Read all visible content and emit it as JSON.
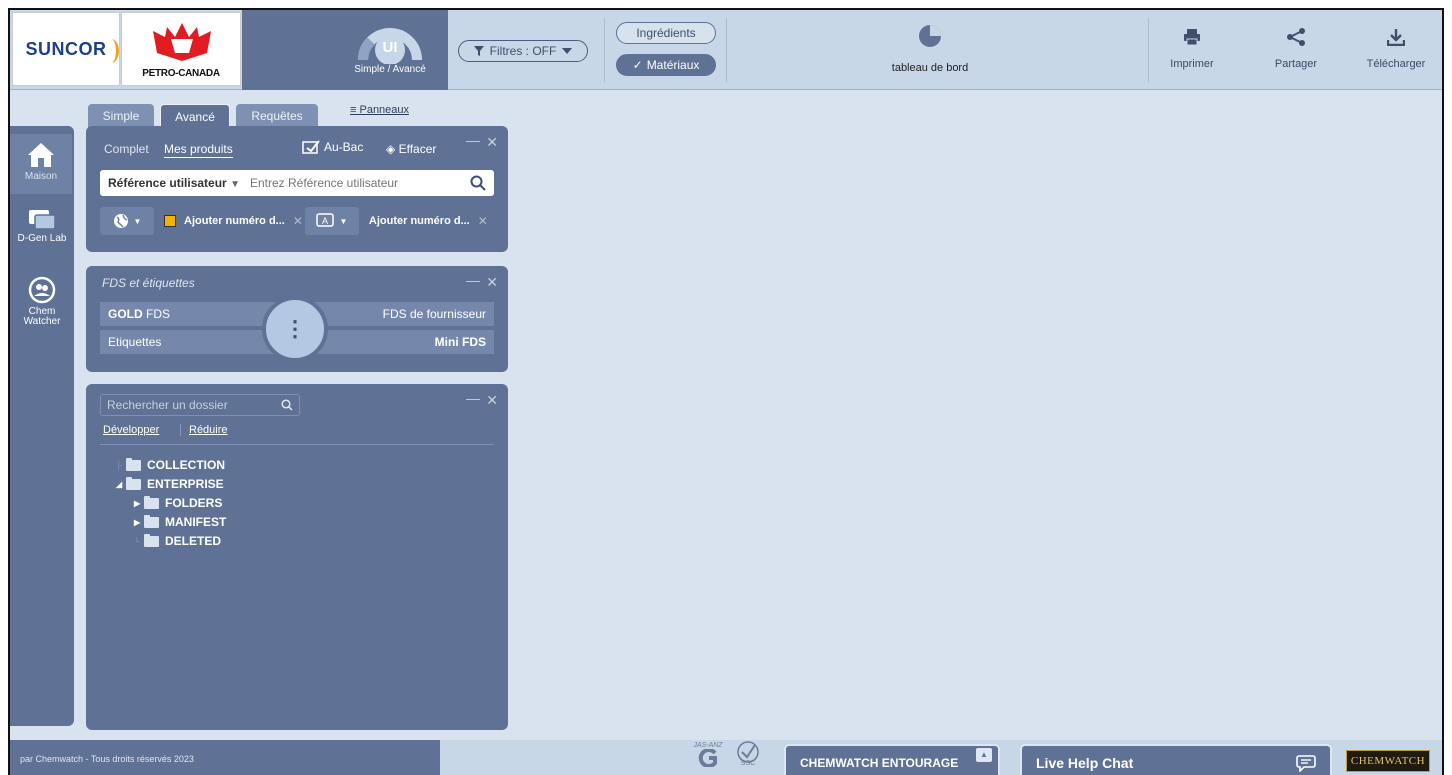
{
  "header": {
    "logos": {
      "suncor": "SUNCOR",
      "petro": "PETRO-CANADA"
    },
    "ui_mode": {
      "badge": "UI",
      "label": "Simple / Avancé"
    },
    "filter": {
      "label": "Filtres : OFF"
    },
    "modes": {
      "ingredients": "Ingrédients",
      "materiaux": "Matériaux"
    },
    "dashboard": {
      "label": "tableau de bord"
    },
    "tools": {
      "print": "Imprimer",
      "share": "Partager",
      "download": "Télécharger"
    }
  },
  "leftnav": {
    "home": "Maison",
    "dgen": "D-Gen Lab",
    "chem_line1": "Chem",
    "chem_line2": "Watcher"
  },
  "tabs": {
    "simple": "Simple",
    "avance": "Avancé",
    "requetes": "Requêtes",
    "panneaux": "Panneaux"
  },
  "search_panel": {
    "complet": "Complet",
    "mes_produits": "Mes produits",
    "au_bac": "Au-Bac",
    "effacer": "Effacer",
    "field_selector": "Référence utilisateur",
    "field_placeholder": "Entrez Référence utilisateur",
    "chip1": "Ajouter numéro d...",
    "chip2": "Ajouter numéro d..."
  },
  "fds_panel": {
    "title": "FDS et étiquettes",
    "gold_prefix": "GOLD",
    "gold_suffix": " FDS",
    "fournisseur": "FDS de fournisseur",
    "etiquettes": "Etiquettes",
    "mini": "Mini FDS"
  },
  "folder_panel": {
    "search_placeholder": "Rechercher un dossier",
    "developper": "Développer",
    "reduire": "Réduire",
    "tree": {
      "collection": "COLLECTION",
      "enterprise": "ENTERPRISE",
      "folders": "FOLDERS",
      "manifest": "MANIFEST",
      "deleted": "DELETED"
    }
  },
  "footer": {
    "copyright": "par Chemwatch - Tous droits réservés 2023",
    "entourage": "CHEMWATCH ENTOURAGE",
    "livehelp": "Live Help Chat",
    "logo": "CHEMWATCH",
    "jasanz": "JAS-ANZ",
    "ssc": "SSC"
  },
  "colors": {
    "panel": "#5f7194",
    "header": "#c8d7e8",
    "background": "#d9e3ef"
  }
}
